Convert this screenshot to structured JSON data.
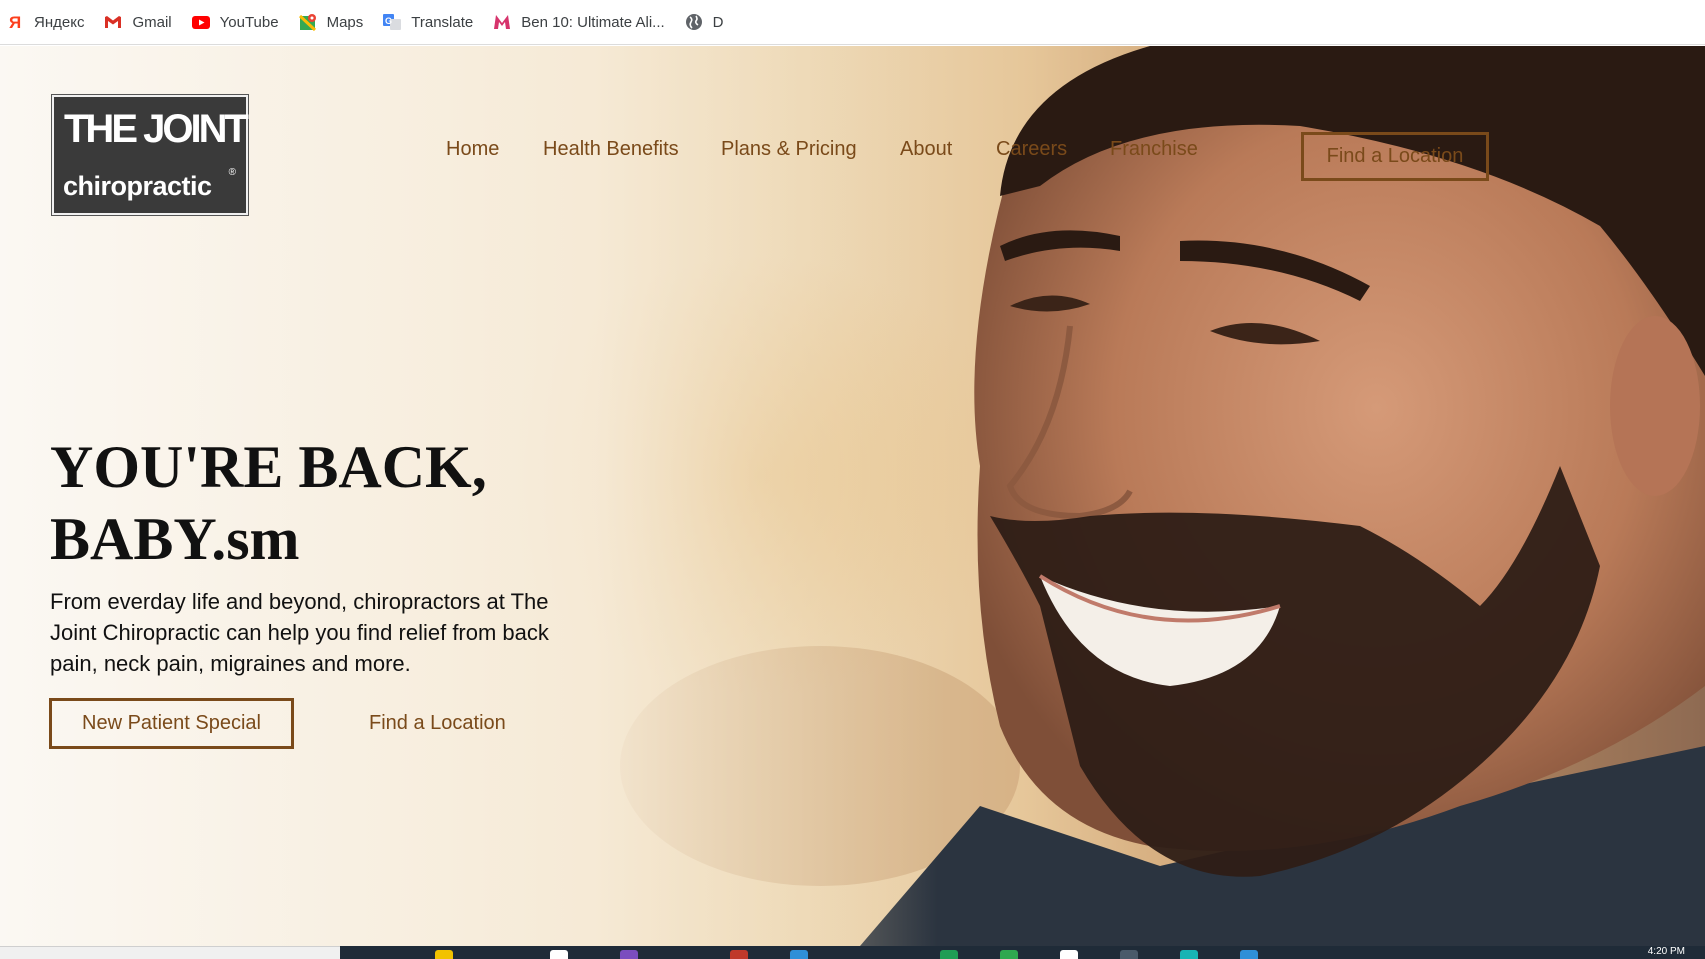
{
  "bookmarks": [
    {
      "label": "Яндекс",
      "icon": "yandex-icon"
    },
    {
      "label": "Gmail",
      "icon": "gmail-icon"
    },
    {
      "label": "YouTube",
      "icon": "youtube-icon"
    },
    {
      "label": "Maps",
      "icon": "maps-icon"
    },
    {
      "label": "Translate",
      "icon": "translate-icon"
    },
    {
      "label": "Ben 10: Ultimate Ali...",
      "icon": "ben10-icon"
    },
    {
      "label": "D",
      "icon": "globe-icon"
    }
  ],
  "logo": {
    "line1": "THE JOINT",
    "line2": "chiropractic",
    "reg": "®"
  },
  "nav": {
    "items": [
      "Home",
      "Health Benefits",
      "Plans & Pricing",
      "About",
      "Careers",
      "Franchise"
    ],
    "cta": "Find a Location"
  },
  "hero": {
    "headline_line1": "YOU'RE BACK,",
    "headline_line2": "BABY.sm",
    "subtext": "From everday life and beyond, chiropractors at The Joint Chiropractic can help you find relief from back pain, neck pain, migraines and more.",
    "primary_button": "New Patient Special",
    "secondary_link": "Find a Location"
  },
  "taskbar": {
    "clock": "4:20 PM"
  },
  "colors": {
    "accent": "#7a4a1a",
    "logo_bg": "#3a3a3a",
    "taskbar": "#1f2b38"
  }
}
